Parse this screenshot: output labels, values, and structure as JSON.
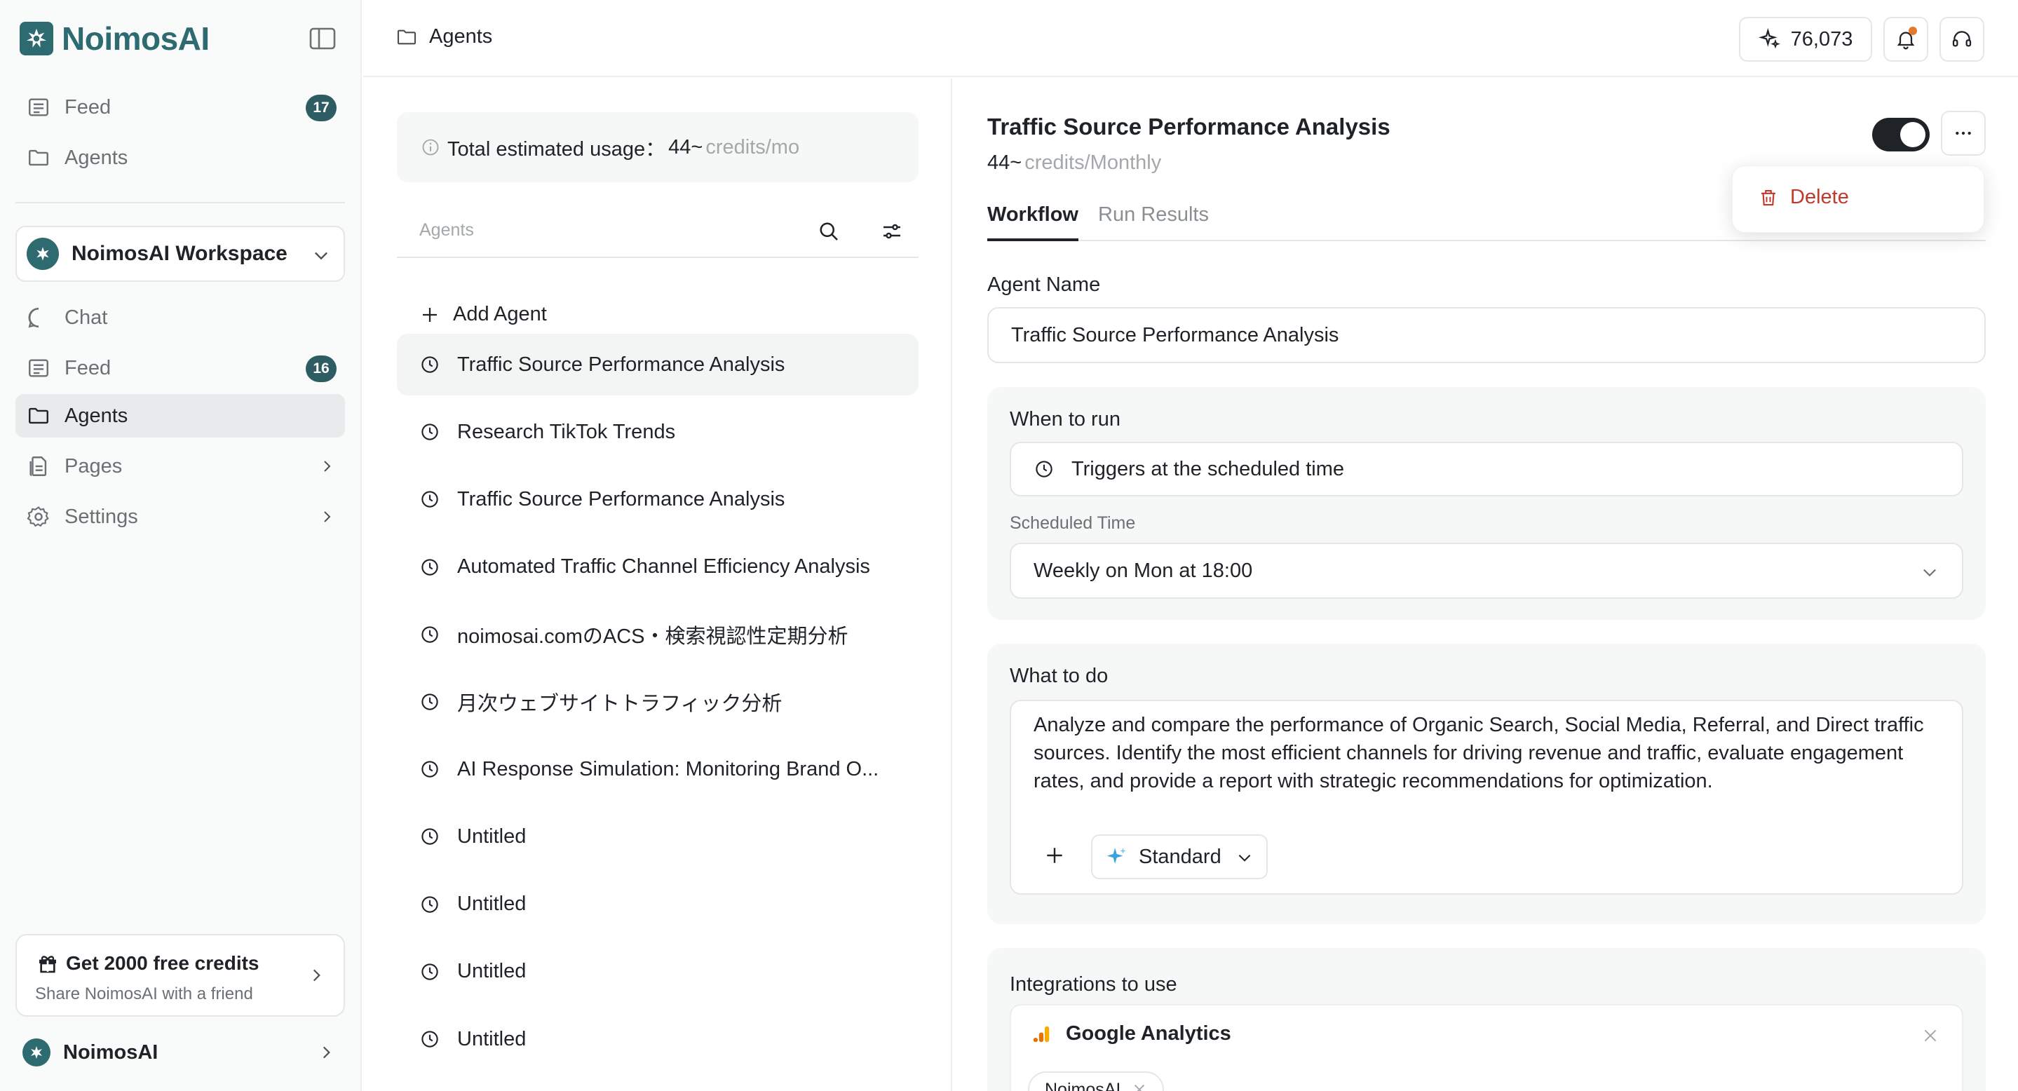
{
  "brand": {
    "name": "NoimosAI",
    "accent": "#2d6b70"
  },
  "sidebar": {
    "top_items": [
      {
        "label": "Feed",
        "icon": "feed-icon",
        "badge": "17"
      },
      {
        "label": "Agents",
        "icon": "folder-icon"
      }
    ],
    "workspace": {
      "name": "NoimosAI Workspace"
    },
    "items": [
      {
        "label": "Chat",
        "icon": "chat-icon"
      },
      {
        "label": "Feed",
        "icon": "feed-icon",
        "badge": "16"
      },
      {
        "label": "Agents",
        "icon": "folder-icon",
        "active": true
      },
      {
        "label": "Pages",
        "icon": "pages-icon"
      },
      {
        "label": "Settings",
        "icon": "gear-icon"
      }
    ],
    "promo": {
      "title": "Get 2000 free credits",
      "subtitle": "Share NoimosAI with a friend"
    },
    "user": {
      "name": "NoimosAI"
    }
  },
  "topbar": {
    "breadcrumb": "Agents",
    "credits": "76,073"
  },
  "list": {
    "usage_label": "Total estimated usage：",
    "usage_value": "44~",
    "usage_unit": "credits/mo",
    "header": "Agents",
    "add_label": "Add Agent",
    "agents": [
      "Traffic Source Performance Analysis",
      "Research TikTok Trends",
      "Traffic Source Performance Analysis",
      "Automated Traffic Channel Efficiency Analysis",
      "noimosai.comのACS・検索視認性定期分析",
      "月次ウェブサイトトラフィック分析",
      "AI Response Simulation: Monitoring Brand O...",
      "Untitled",
      "Untitled",
      "Untitled",
      "Untitled"
    ],
    "selected_index": 0
  },
  "detail": {
    "title": "Traffic Source Performance Analysis",
    "credits_value": "44~",
    "credits_unit": "credits/Monthly",
    "enabled": true,
    "tabs": [
      "Workflow",
      "Run Results"
    ],
    "agent_name_label": "Agent Name",
    "agent_name_value": "Traffic Source Performance Analysis",
    "when_label": "When to run",
    "trigger_value": "Triggers at the scheduled time",
    "scheduled_label": "Scheduled Time",
    "scheduled_value": "Weekly on Mon at 18:00",
    "what_label": "What to do",
    "what_value": "Analyze and compare the performance of Organic Search, Social Media, Referral, and Direct traffic sources. Identify the most efficient channels for driving revenue and traffic, evaluate engagement rates, and provide a report with strategic recommendations for optimization.",
    "model_label": "Standard",
    "integrations_label": "Integrations to use",
    "integration_name": "Google Analytics",
    "integration_chip": "NoimosAI"
  },
  "menu": {
    "delete_label": "Delete",
    "delete_color": "#c0392b"
  }
}
